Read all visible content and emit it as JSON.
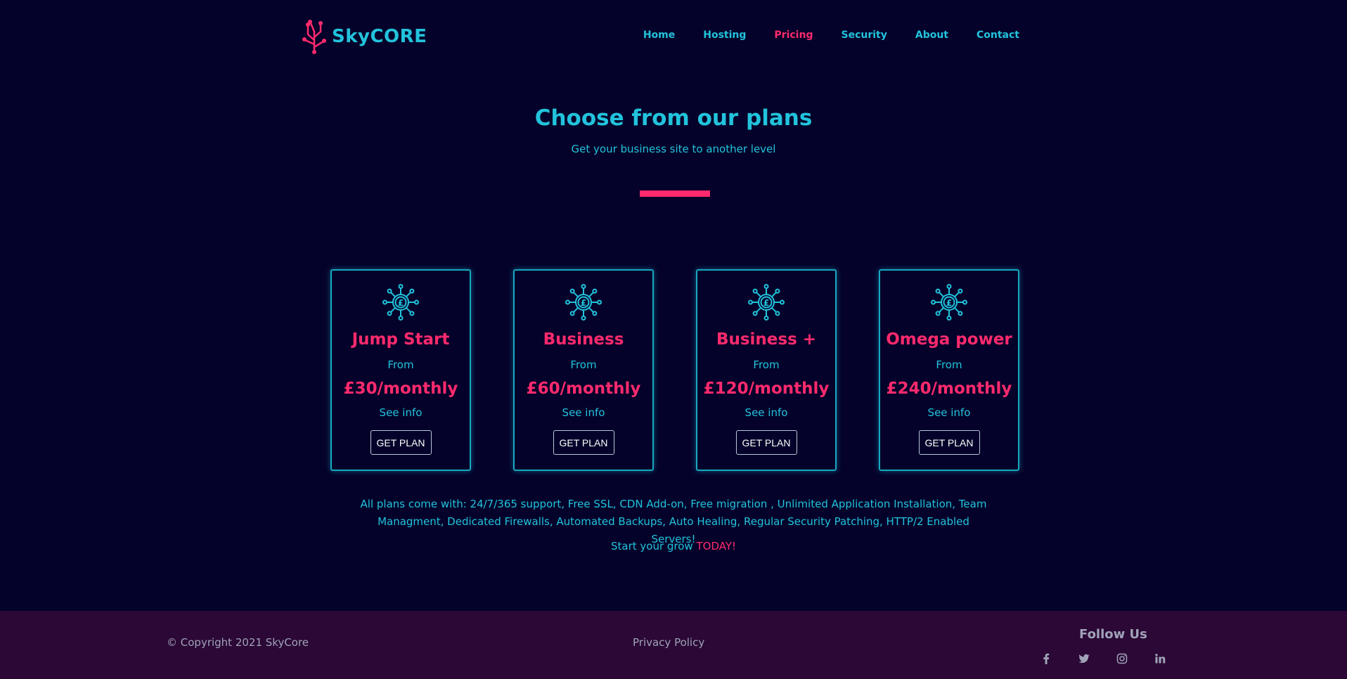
{
  "brand": {
    "name_part1": "Sky",
    "name_part2": "CORE"
  },
  "nav": [
    {
      "label": "Home",
      "active": false
    },
    {
      "label": "Hosting",
      "active": false
    },
    {
      "label": "Pricing",
      "active": true
    },
    {
      "label": "Security",
      "active": false
    },
    {
      "label": "About",
      "active": false
    },
    {
      "label": "Contact",
      "active": false
    }
  ],
  "hero": {
    "title": "Choose from our plans",
    "subtitle": "Get your business site to another level"
  },
  "plans": [
    {
      "name": "Jump Start",
      "from": "From",
      "price": "£30/monthly",
      "info": "See info",
      "button": "GET PLAN",
      "icon": "pound-coin-network-icon"
    },
    {
      "name": "Business",
      "from": "From",
      "price": "£60/monthly",
      "info": "See info",
      "button": "GET PLAN",
      "icon": "pound-coin-network-icon"
    },
    {
      "name": "Business +",
      "from": "From",
      "price": "£120/monthly",
      "info": "See info",
      "button": "GET PLAN",
      "icon": "pound-coin-network-icon"
    },
    {
      "name": "Omega power",
      "from": "From",
      "price": "£240/monthly",
      "info": "See info",
      "button": "GET PLAN",
      "icon": "pound-coin-network-icon"
    }
  ],
  "features": "All plans come with: 24/7/365 support, Free SSL, CDN Add-on, Free migration , Unlimited Application Installation, Team Managment, Dedicated Firewalls, Automated Backups, Auto Healing, Regular Security Patching, HTTP/2 Enabled Servers!",
  "cta": {
    "text": "Start your grow ",
    "highlight": "TODAY!"
  },
  "footer": {
    "copyright": "© Copyright 2021 SkyCore",
    "privacy": "Privacy Policy",
    "follow": "Follow Us",
    "socials": [
      "facebook-icon",
      "twitter-icon",
      "instagram-icon",
      "linkedin-icon"
    ]
  },
  "colors": {
    "background": "#04022a",
    "accent_cyan": "#22c3dc",
    "accent_pink": "#ff2a6d",
    "footer_bg": "#2b0835"
  }
}
